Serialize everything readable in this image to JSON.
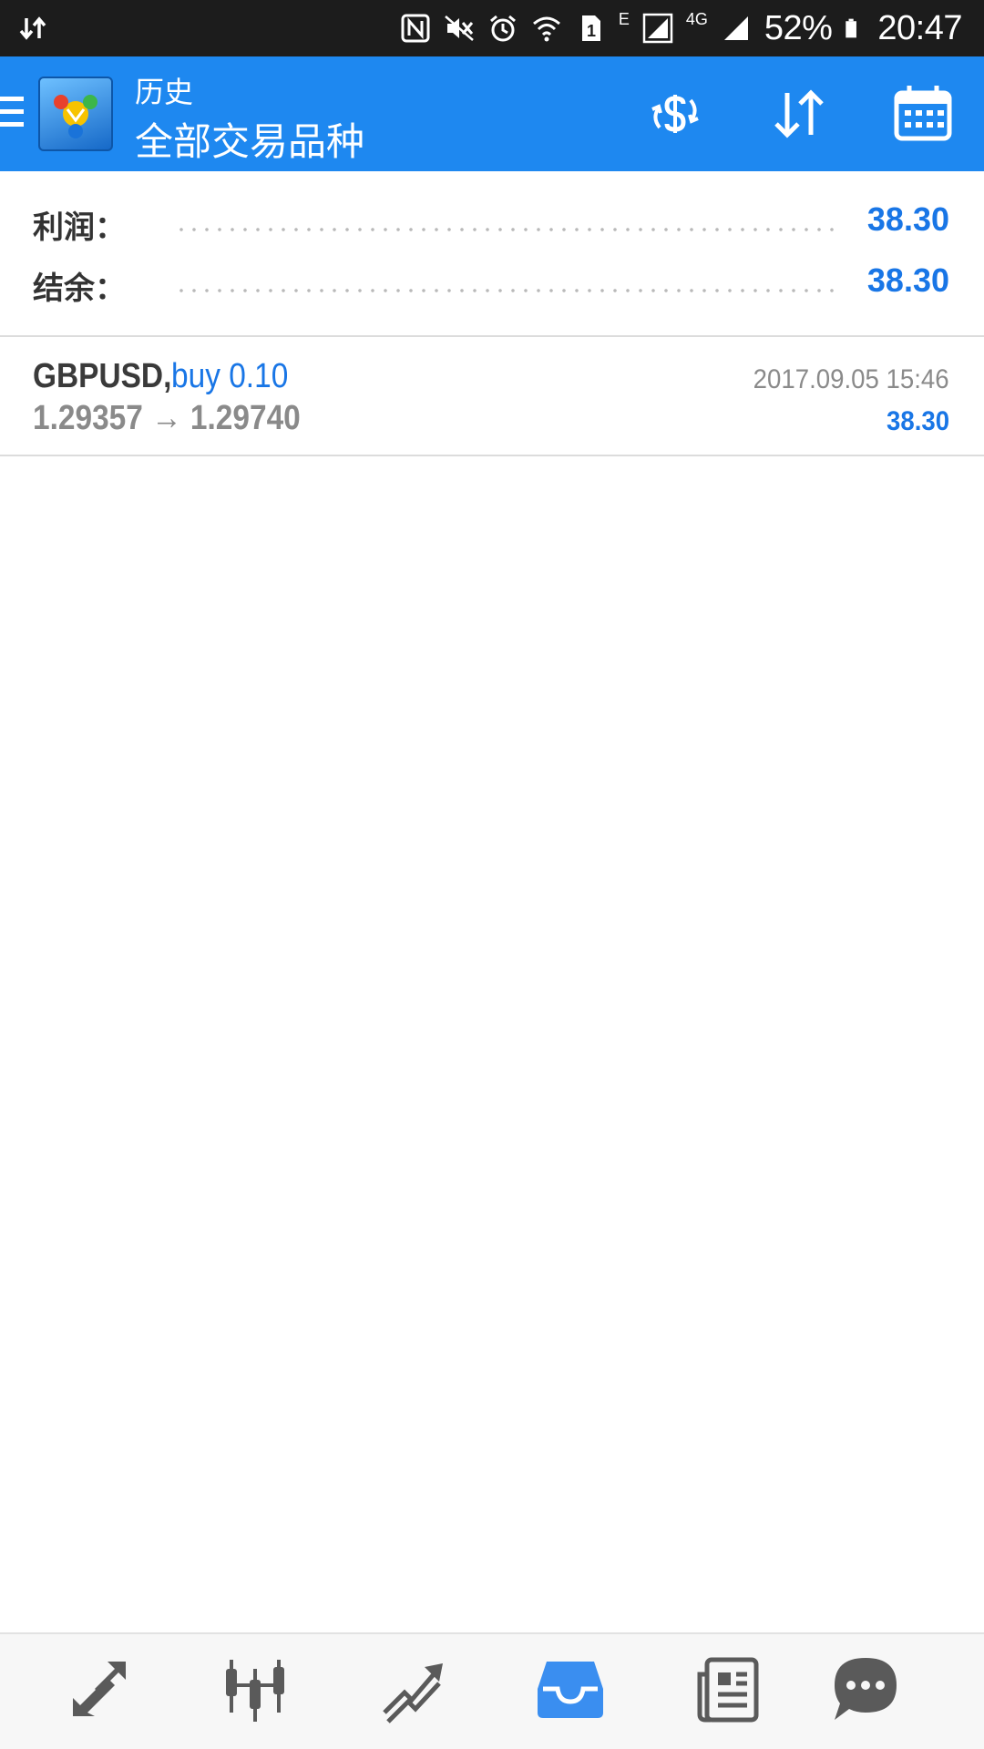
{
  "status_bar": {
    "battery": "52%",
    "time": "20:47",
    "network_e": "E",
    "network_4g": "4G",
    "sim_slot": "1",
    "icons": [
      "data-transfer-icon",
      "nfc-icon",
      "mute-icon",
      "alarm-icon",
      "wifi-icon",
      "sim-1-icon",
      "signal-icon",
      "battery-icon"
    ]
  },
  "app_bar": {
    "title": "历史",
    "subtitle": "全部交易品种",
    "icons": [
      "menu-icon",
      "app-logo",
      "exchange-icon",
      "sort-icon",
      "calendar-icon"
    ]
  },
  "summary": {
    "profit_label": "利润：",
    "profit_value": "38.30",
    "balance_label": "结余：",
    "balance_value": "38.30"
  },
  "deals": [
    {
      "symbol": "GBPUSD,",
      "type": "buy 0.10",
      "prices": "1.29357 → 1.29740",
      "time": "2017.09.05 15:46",
      "profit": "38.30"
    }
  ],
  "bottom_nav": {
    "items": [
      "trade-icon",
      "quotes-icon",
      "chart-icon",
      "history-icon",
      "news-icon",
      "chat-icon"
    ],
    "active": "history-icon"
  },
  "colors": {
    "status_bar": "#1c1c1c",
    "app_bar": "#1e88f0",
    "accent": "#1976e6",
    "text_dark": "#333333",
    "text_gray": "#8a8a8a",
    "nav_icon": "#5a5a5a",
    "nav_active": "#3a8ef0"
  }
}
